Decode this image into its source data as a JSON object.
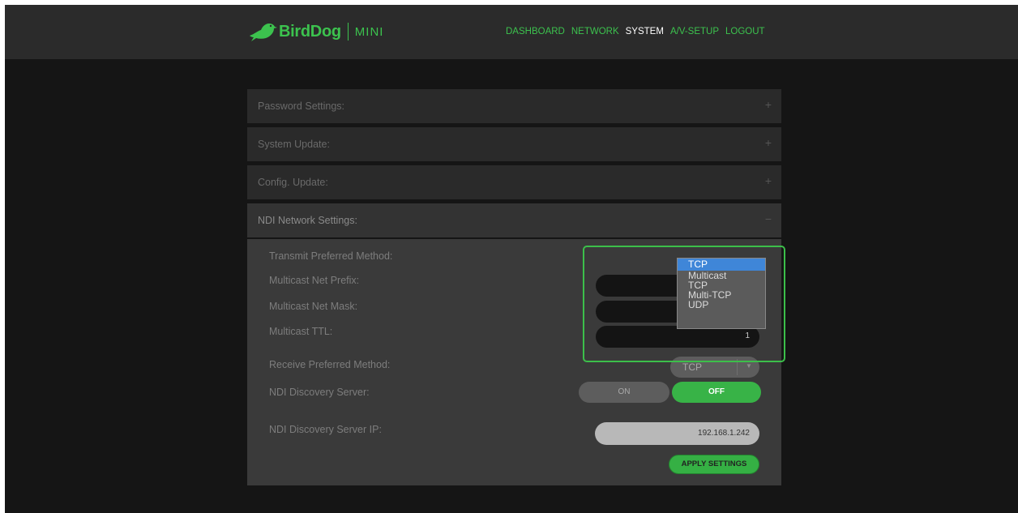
{
  "header": {
    "brand": "BirdDog",
    "product": "MINI",
    "nav": [
      {
        "label": "DASHBOARD",
        "active": false
      },
      {
        "label": "NETWORK",
        "active": false
      },
      {
        "label": "SYSTEM",
        "active": true
      },
      {
        "label": "A/V-SETUP",
        "active": false
      },
      {
        "label": "LOGOUT",
        "active": false
      }
    ]
  },
  "accordion": [
    {
      "title": "Password Settings:",
      "icon": "+"
    },
    {
      "title": "System Update:",
      "icon": "+"
    },
    {
      "title": "Config. Update:",
      "icon": "+"
    },
    {
      "title": "NDI Network Settings:",
      "icon": "−"
    }
  ],
  "ndi": {
    "transmit_label": "Transmit Preferred Method:",
    "prefix_label": "Multicast Net Prefix:",
    "mask_label": "Multicast Net Mask:",
    "ttl_label": "Multicast TTL:",
    "ttl_value": "1",
    "receive_label": "Receive Preferred Method:",
    "receive_value": "TCP",
    "discovery_label": "NDI Discovery Server:",
    "discovery_on": "ON",
    "discovery_off": "OFF",
    "discovery_ip_label": "NDI Discovery Server IP:",
    "discovery_ip_value": "192.168.1.242",
    "apply_label": "APPLY SETTINGS"
  },
  "transmit_dropdown": {
    "options": [
      "TCP",
      "Multicast",
      "TCP",
      "Multi-TCP",
      "UDP"
    ],
    "selected_index": 0
  },
  "colors": {
    "accent": "#3cc24e",
    "selection": "#3f86d8"
  }
}
